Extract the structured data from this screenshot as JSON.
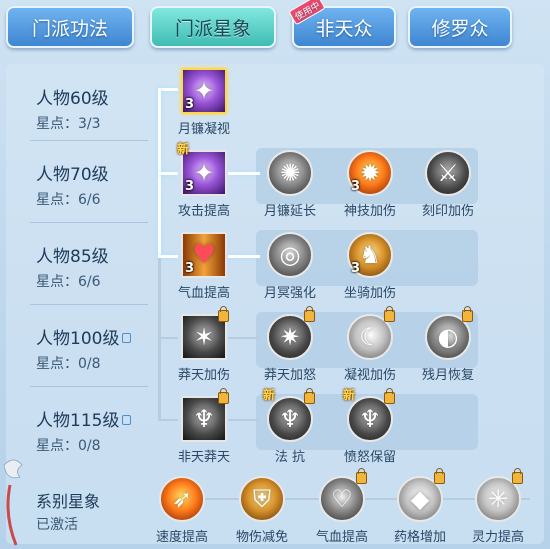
{
  "tabs": [
    {
      "label": "门派功法",
      "active": false
    },
    {
      "label": "门派星象",
      "active": true
    },
    {
      "label": "非天众",
      "active": false,
      "badge": "使用中"
    },
    {
      "label": "修罗众",
      "active": false
    }
  ],
  "levels": [
    {
      "name": "人物60级",
      "points": "星点：3/3",
      "locked": false
    },
    {
      "name": "人物70级",
      "points": "星点：6/6",
      "locked": false
    },
    {
      "name": "人物85级",
      "points": "星点：6/6",
      "locked": false
    },
    {
      "name": "人物100级",
      "points": "星点：0/8",
      "locked": true
    },
    {
      "name": "人物115级",
      "points": "星点：0/8",
      "locked": true
    }
  ],
  "rows": [
    {
      "nodes": [
        {
          "label": "月镰凝视",
          "level": "3",
          "icon": "purple-claw-icon",
          "new": false,
          "locked": false
        }
      ]
    },
    {
      "nodes": [
        {
          "label": "攻击提高",
          "level": "3",
          "icon": "purple-claw-icon",
          "new": true,
          "new_label": "新",
          "locked": false
        },
        {
          "label": "月镰延长",
          "level": "",
          "icon": "blade-spin-icon",
          "new": false,
          "locked": false
        },
        {
          "label": "神技加伤",
          "level": "3",
          "icon": "fire-beast-icon",
          "new": false,
          "locked": false
        },
        {
          "label": "刻印加伤",
          "level": "",
          "icon": "rune-mark-icon",
          "new": false,
          "locked": false
        }
      ]
    },
    {
      "nodes": [
        {
          "label": "气血提高",
          "level": "3",
          "icon": "heart-icon",
          "new": false,
          "locked": false
        },
        {
          "label": "月冥强化",
          "level": "",
          "icon": "dark-orb-icon",
          "new": false,
          "locked": false
        },
        {
          "label": "坐骑加伤",
          "level": "3",
          "icon": "golden-mount-icon",
          "new": false,
          "locked": false
        }
      ]
    },
    {
      "nodes": [
        {
          "label": "莽天加伤",
          "level": "",
          "icon": "burst-icon",
          "new": false,
          "locked": true
        },
        {
          "label": "莽天加怒",
          "level": "",
          "icon": "burst-swirl-icon",
          "new": false,
          "locked": true
        },
        {
          "label": "凝视加伤",
          "level": "",
          "icon": "moon-gaze-icon",
          "new": false,
          "locked": true
        },
        {
          "label": "残月恢复",
          "level": "",
          "icon": "crescent-ring-icon",
          "new": false,
          "locked": true
        }
      ]
    },
    {
      "nodes": [
        {
          "label": "非天莽天",
          "level": "",
          "icon": "winged-figure-icon",
          "new": false,
          "locked": true
        },
        {
          "label": "法 抗",
          "level": "",
          "icon": "winged-figure-icon",
          "new": true,
          "new_label": "新",
          "locked": true
        },
        {
          "label": "愤怒保留",
          "level": "",
          "icon": "winged-figure-icon",
          "new": true,
          "new_label": "新",
          "locked": true
        }
      ]
    }
  ],
  "school": {
    "title": "系别星象",
    "status": "已激活",
    "nodes": [
      {
        "label": "速度提高",
        "icon": "speed-icon",
        "locked": false
      },
      {
        "label": "物伤减免",
        "icon": "golden-guard-icon",
        "locked": false
      },
      {
        "label": "气血提高",
        "icon": "heart-outline-icon",
        "locked": true
      },
      {
        "label": "药格增加",
        "icon": "crystal-icon",
        "locked": true
      },
      {
        "label": "灵力提高",
        "icon": "spirit-star-icon",
        "locked": true
      }
    ]
  },
  "colors": {
    "tab_blue": "#4f97de",
    "tab_active": "#5ed0c6",
    "badge_red": "#e84a6d",
    "panel_bg": "#cfe3f3",
    "text_dark": "#1d3b5a",
    "new_gold": "#ffd84a"
  }
}
